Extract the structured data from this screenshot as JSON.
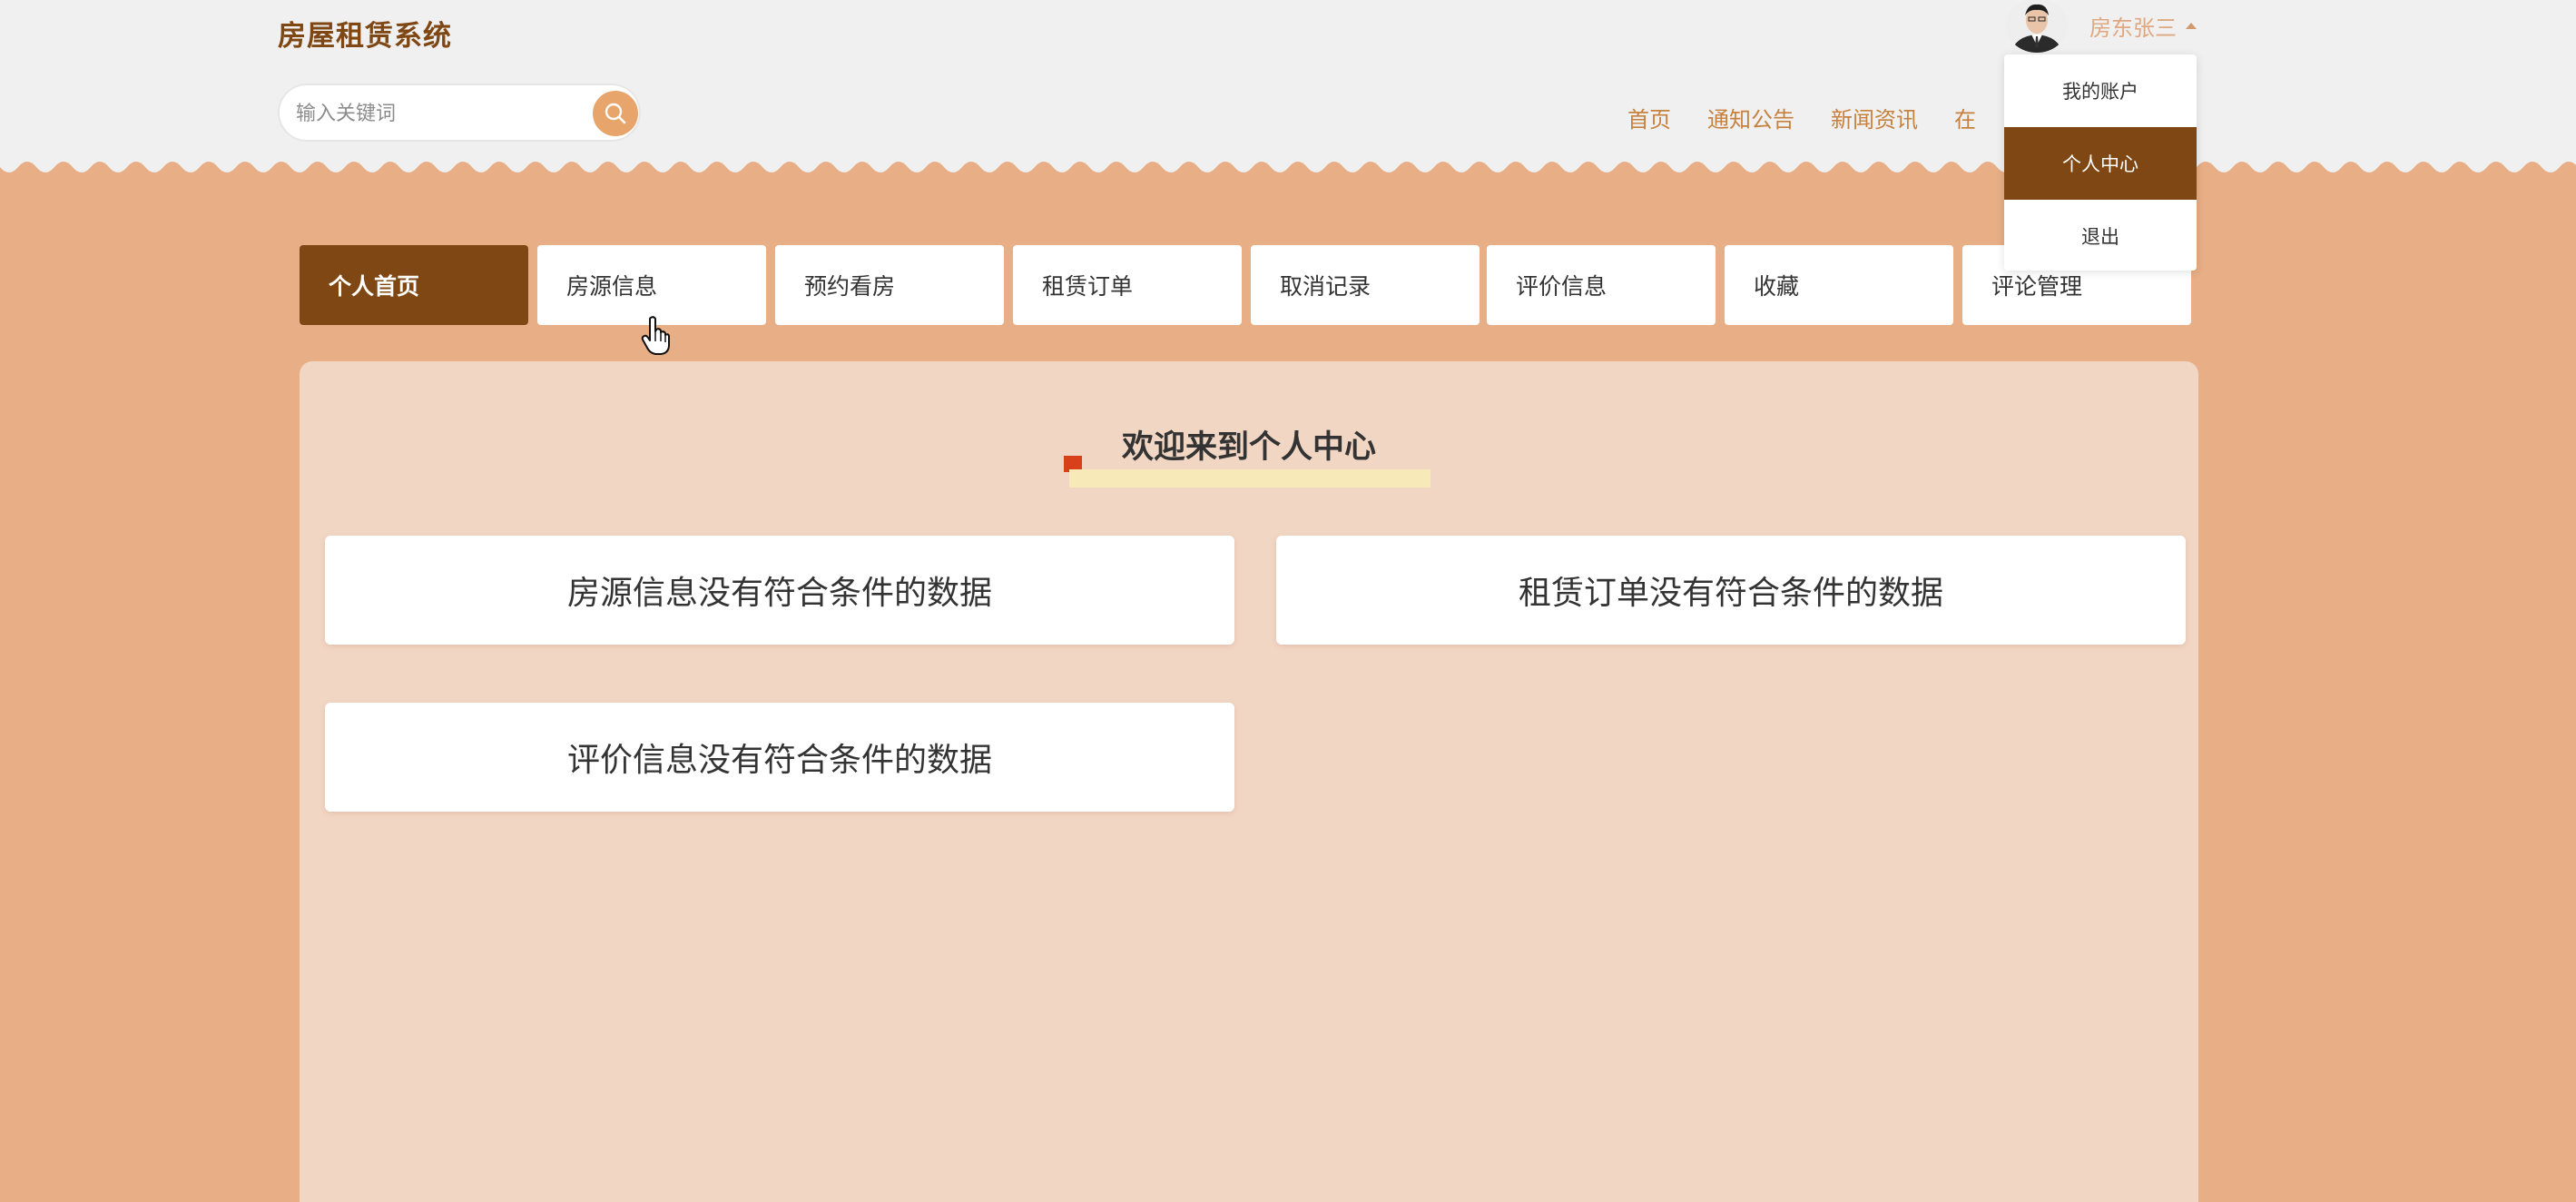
{
  "header": {
    "site_title": "房屋租赁系统",
    "search": {
      "placeholder": "输入关键词",
      "value": ""
    },
    "nav": [
      "首页",
      "通知公告",
      "新闻资讯",
      "在"
    ],
    "user": {
      "name": "房东张三"
    },
    "dropdown": {
      "items": [
        "我的账户",
        "个人中心",
        "退出"
      ],
      "active": "个人中心"
    }
  },
  "tabs": {
    "items": [
      "个人首页",
      "房源信息",
      "预约看房",
      "租赁订单",
      "取消记录",
      "评价信息",
      "收藏",
      "评论管理"
    ],
    "active": "个人首页"
  },
  "main": {
    "welcome_title": "欢迎来到个人中心",
    "cards": [
      "房源信息没有符合条件的数据",
      "租赁订单没有符合条件的数据",
      "评价信息没有符合条件的数据"
    ]
  },
  "colors": {
    "brand": "#7f4713",
    "background": "#e8ae85",
    "panel": "#f1d6c4",
    "nav_text": "#c6813f",
    "search_button": "#e8a56b"
  }
}
